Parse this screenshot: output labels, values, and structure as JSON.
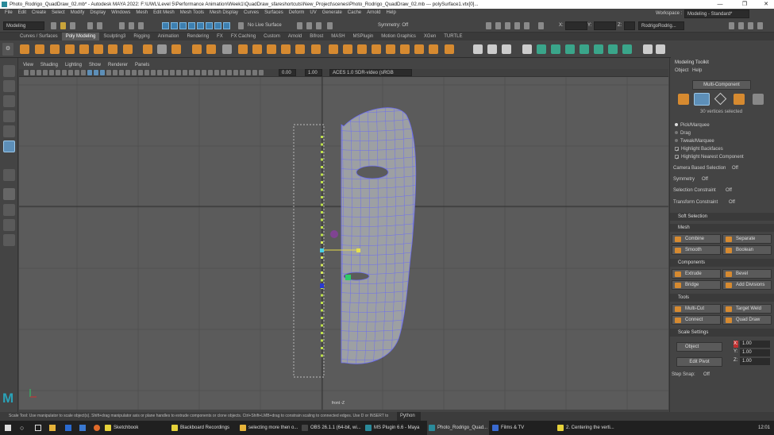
{
  "titlebar": {
    "title": "Photo_Rodrigo_QuadDraw_02.mb* - Autodesk MAYA 2022: F:\\UWL\\Level 5\\Performance Animation\\Week1\\QuadDraw_sfareshortcuts\\New_Project\\scenes\\Photo_Rodrigo_QuadDraw_02.mb  ---  polySurface1.vtx[0]..."
  },
  "menubar": {
    "items": [
      "File",
      "Edit",
      "Create",
      "Select",
      "Modify",
      "Display",
      "Windows",
      "Mesh",
      "Edit Mesh",
      "Mesh Tools",
      "Mesh Display",
      "Curves",
      "Surfaces",
      "Deform",
      "UV",
      "Generate",
      "Cache",
      "Arnold",
      "Help"
    ]
  },
  "status": {
    "mode": "Modeling",
    "live": "No Live Surface",
    "symmetry": "Symmetry: Off",
    "x_label": "X:",
    "y_label": "Y:",
    "z_label": "Z:",
    "user": "RodrigoRodrig...",
    "workspace_label": "Workspace :",
    "workspace": "Modeling - Standard*"
  },
  "shelf": {
    "tabs": [
      "Curves / Surfaces",
      "Poly Modeling",
      "Sculpting3",
      "Rigging",
      "Animation",
      "Rendering",
      "FX",
      "FX Caching",
      "Custom",
      "Arnold",
      "Bifrost",
      "MASH",
      "MSPlugin",
      "Motion Graphics",
      "XGen",
      "TURTLE"
    ],
    "active": "Poly Modeling"
  },
  "panel": {
    "menus": [
      "View",
      "Shading",
      "Lighting",
      "Show",
      "Renderer",
      "Panels"
    ],
    "near": "0.00",
    "far": "1.00",
    "colorspace": "ACES 1.0 SDR-video (sRGB"
  },
  "viewport": {
    "camera": "front -Z"
  },
  "toolkit": {
    "header": "Modeling Toolkit",
    "menus": [
      "Object",
      "Help"
    ],
    "multi": "Multi-Component",
    "selected": "30 vertices selected",
    "modes": [
      "Pick/Marquee",
      "Drag",
      "Tweak/Marquee"
    ],
    "checks": [
      "Highlight Backfaces",
      "Highlight Nearest Component"
    ],
    "props": [
      {
        "label": "Camera Based Selection",
        "value": "Off"
      },
      {
        "label": "Symmetry",
        "value": "Off"
      },
      {
        "label": "Selection Constraint",
        "value": "Off"
      },
      {
        "label": "Transform Constraint",
        "value": "Off"
      }
    ],
    "soft": "Soft Selection",
    "sections": {
      "mesh": "Mesh",
      "components": "Components",
      "tools": "Tools",
      "scale": "Scale Settings"
    },
    "mesh_btns": [
      "Combine",
      "Separate",
      "Smooth",
      "Boolean"
    ],
    "comp_btns": [
      "Extrude",
      "Bevel",
      "Bridge",
      "Add Divisions"
    ],
    "tool_btns": [
      "Multi-Cut",
      "Target Weld",
      "Connect",
      "Quad Draw"
    ],
    "scale": {
      "space": "Object",
      "x_label": "X:",
      "y_label": "Y:",
      "z_label": "Z:",
      "x": "1.00",
      "y": "1.00",
      "z": "1.00",
      "edit_pivot": "Edit Pivot",
      "step_label": "Step Snap:",
      "step": "Off"
    }
  },
  "help": {
    "text": "Scale Tool: Use manipulator to scale object(s). Shift+drag manipulator axis or plane handles to extrude components or clone objects. Ctrl+Shift+LMB+drag to constrain scaling to connected edges. Use D or INSERT to",
    "python": "Python"
  },
  "taskbar": {
    "items": [
      "Sketchbook",
      "Blackboard Recordings",
      "selecting more then o...",
      "OBS 26.1.1 (64-bit, wi...",
      "MS Plugin 6.6 - Maya",
      "Photo_Rodrigo_Quad...",
      "Films & TV",
      "2. Centering the verti..."
    ],
    "clock": "12:01"
  }
}
